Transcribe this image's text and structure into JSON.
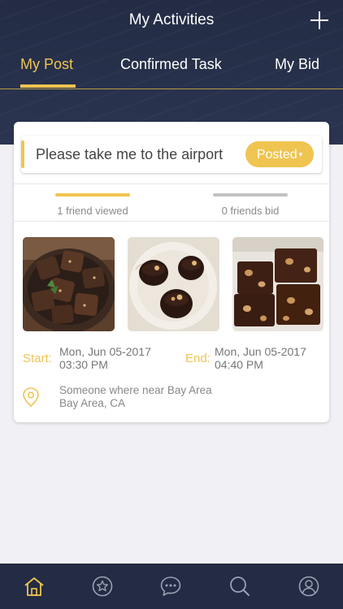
{
  "header": {
    "title": "My Activities"
  },
  "tabs": [
    {
      "label": "My Post",
      "active": true
    },
    {
      "label": "Confirmed Task",
      "active": false
    },
    {
      "label": "My Bid",
      "active": false
    }
  ],
  "post": {
    "input_text": "Please take me to the airport",
    "status_label": "Posted",
    "status_caret": "▾",
    "stats": [
      {
        "label": "1 friend viewed",
        "color": "#f0c451"
      },
      {
        "label": "0 friends bid",
        "color": "#c2c2c2"
      }
    ],
    "start_label": "Start:",
    "start_date": "Mon, Jun 05-2017",
    "start_time": "03:30 PM",
    "end_label": "End:",
    "end_date": "Mon, Jun 05-2017",
    "end_time": "04:40 PM",
    "location_line1": "Someone where near Bay Area",
    "location_line2": "Bay Area, CA"
  },
  "bottom_nav": [
    "home-icon",
    "star-icon",
    "chat-icon",
    "search-icon",
    "profile-icon"
  ],
  "colors": {
    "accent": "#f0c451",
    "navy": "#232c44"
  }
}
